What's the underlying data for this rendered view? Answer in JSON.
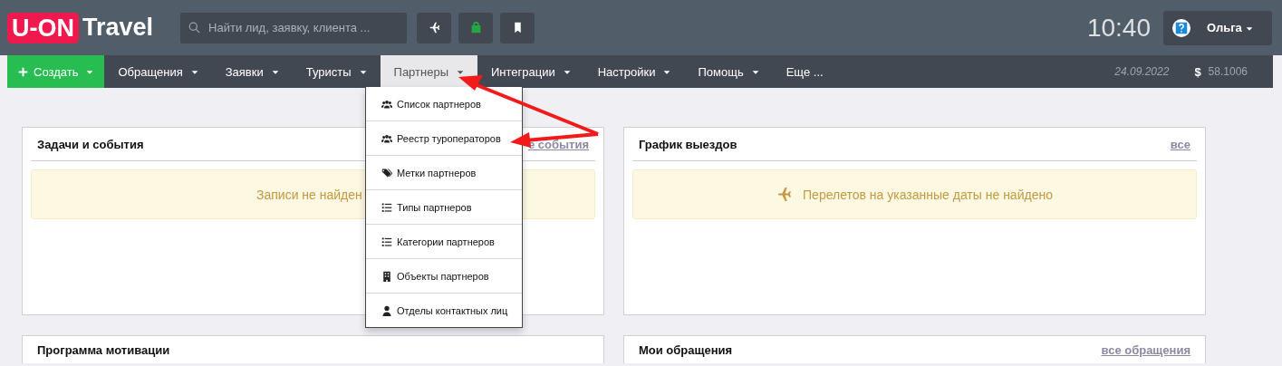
{
  "header": {
    "logo": {
      "badge": "U-ON",
      "text": "Travel"
    },
    "search": {
      "placeholder": "Найти лид, заявку, клиента ..."
    },
    "quick_buttons": [
      {
        "kind": "plane"
      },
      {
        "kind": "bag"
      },
      {
        "kind": "bookmark"
      }
    ],
    "clock": "10:40",
    "user": {
      "name": "Ольга"
    }
  },
  "nav": {
    "items": [
      {
        "label": "Создать",
        "kind": "create",
        "selected": false,
        "caret": true
      },
      {
        "label": "Обращения",
        "kind": "menu",
        "selected": false,
        "caret": true
      },
      {
        "label": "Заявки",
        "kind": "menu",
        "selected": false,
        "caret": true
      },
      {
        "label": "Туристы",
        "kind": "menu",
        "selected": false,
        "caret": true
      },
      {
        "label": "Партнеры",
        "kind": "menu",
        "selected": true,
        "caret": true
      },
      {
        "label": "Интеграции",
        "kind": "menu",
        "selected": false,
        "caret": true
      },
      {
        "label": "Настройки",
        "kind": "menu",
        "selected": false,
        "caret": true
      },
      {
        "label": "Помощь",
        "kind": "menu",
        "selected": false,
        "caret": true
      },
      {
        "label": "Еще ...",
        "kind": "menu",
        "selected": false,
        "caret": false
      }
    ],
    "date": "24.09.2022",
    "currency_symbol": "$",
    "rate": "58.1006"
  },
  "dropdown": {
    "items": [
      {
        "label": "Список партнеров",
        "kind": "users"
      },
      {
        "label": "Реестр туроператоров",
        "kind": "users"
      },
      {
        "label": "Метки партнеров",
        "kind": "tags"
      },
      {
        "label": "Типы партнеров",
        "kind": "list"
      },
      {
        "label": "Категории партнеров",
        "kind": "list"
      },
      {
        "label": "Объекты партнеров",
        "kind": "building"
      },
      {
        "label": "Отделы контактных лиц",
        "kind": "user"
      }
    ]
  },
  "panels": [
    {
      "title": "Задачи и события",
      "link": "е события",
      "alert": {
        "text": "Записи не найден",
        "kind": "plain"
      }
    },
    {
      "title": "График выездов",
      "link": "все",
      "alert": {
        "text": "Перелетов на указанные даты не найдено",
        "kind": "flight"
      }
    },
    {
      "title": "Программа мотивации"
    },
    {
      "title": "Мои обращения",
      "link": "все обращения"
    }
  ]
}
